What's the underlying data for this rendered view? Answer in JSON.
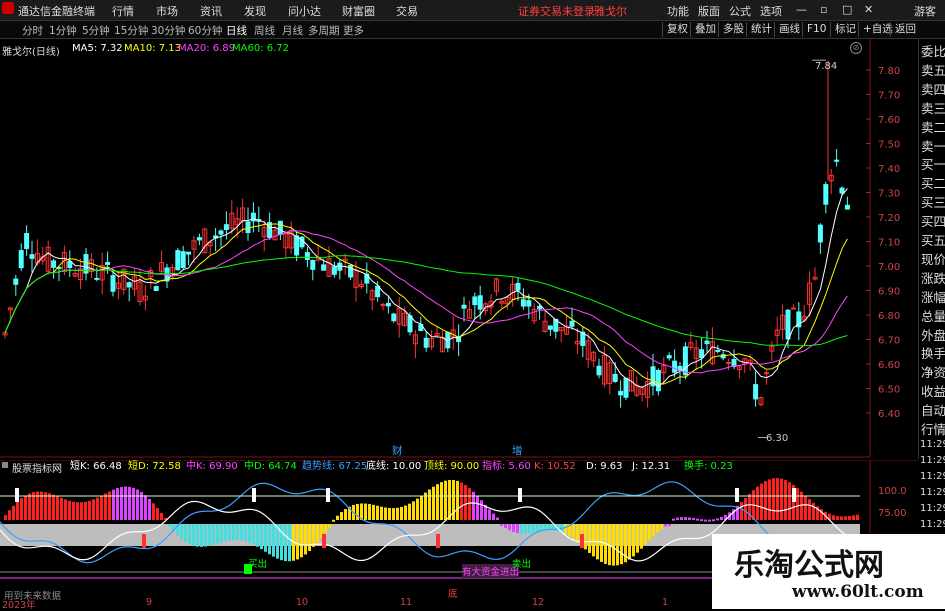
{
  "titlebar": {
    "app_title": "通达信金融终端",
    "menus": [
      "行情",
      "市场",
      "资讯",
      "发现",
      "问小达",
      "财富圈",
      "交易"
    ],
    "notice": "证券交易未登录",
    "stock": "雅戈尔",
    "tools": [
      "功能",
      "版面",
      "公式",
      "选项"
    ],
    "guest": "游客"
  },
  "periodbar": {
    "periods": [
      "分时",
      "1分钟",
      "5分钟",
      "15分钟",
      "30分钟",
      "60分钟",
      "日线",
      "周线",
      "月线",
      "多周期",
      "更多"
    ],
    "tools": [
      "复权",
      "叠加",
      "多股",
      "统计",
      "画线",
      "F10",
      "标记",
      "+自选",
      "返回"
    ]
  },
  "main_chart": {
    "stock_label": "雅戈尔(日线)",
    "ma": [
      {
        "label": "MA5: 7.32",
        "color": "#ffffff"
      },
      {
        "label": "MA10: 7.13",
        "color": "#ffff00"
      },
      {
        "label": "MA20: 6.89",
        "color": "#ff44ff"
      },
      {
        "label": "MA60: 6.72",
        "color": "#00ff00"
      }
    ],
    "price_ticks": [
      "7.80",
      "7.70",
      "7.60",
      "7.50",
      "7.40",
      "7.30",
      "7.20",
      "7.10",
      "7.00",
      "6.90",
      "6.80",
      "6.70",
      "6.60",
      "6.50",
      "6.40"
    ],
    "high_label": "7.84",
    "low_label": "6.30",
    "markers": [
      "财",
      "增"
    ]
  },
  "right_panel": [
    "委比",
    "卖五",
    "卖四",
    "卖三",
    "卖二",
    "卖一",
    "买一",
    "买二",
    "买三",
    "买四",
    "买五",
    "现价",
    "涨跌",
    "涨幅",
    "总量",
    "外盘",
    "换手",
    "净资",
    "收益",
    "自动",
    "行情"
  ],
  "time_column": [
    "11:29",
    "11:29",
    "11:29",
    "11:29",
    "11:29",
    "11:29",
    "11:29",
    "11:29"
  ],
  "sub_chart": {
    "title": "股票指标网",
    "values": [
      {
        "label": "短K: 66.48",
        "color": "#ffffff"
      },
      {
        "label": "短D: 72.58",
        "color": "#ffff00"
      },
      {
        "label": "中K: 69.90",
        "color": "#ff44ff"
      },
      {
        "label": "中D: 64.74",
        "color": "#00ff00"
      },
      {
        "label": "趋势线: 67.25",
        "color": "#3aa0ff"
      },
      {
        "label": "底线: 10.00",
        "color": "#ffffff"
      },
      {
        "label": "顶线: 90.00",
        "color": "#ffff00"
      },
      {
        "label": "指标: 5.60",
        "color": "#ff44ff"
      },
      {
        "label": "K: 10.52",
        "color": "#ff4040"
      },
      {
        "label": "D: 9.63",
        "color": "#ffffff"
      },
      {
        "label": "J: 12.31",
        "color": "#ffffff"
      },
      {
        "label": "换手: 0.23",
        "color": "#00ff00"
      }
    ],
    "ticks": [
      "100.0",
      "75.00"
    ],
    "note": "用到未来数据",
    "labels": {
      "buy1": "买出",
      "buy2": "卖出",
      "sell1": "卖出",
      "fund": "有大资金进出",
      "bottom": "底"
    }
  },
  "date_axis": [
    "2023年",
    "9",
    "10",
    "11",
    "12",
    "1"
  ],
  "watermark": {
    "title": "乐淘公式网",
    "url": "www.60lt.com"
  }
}
